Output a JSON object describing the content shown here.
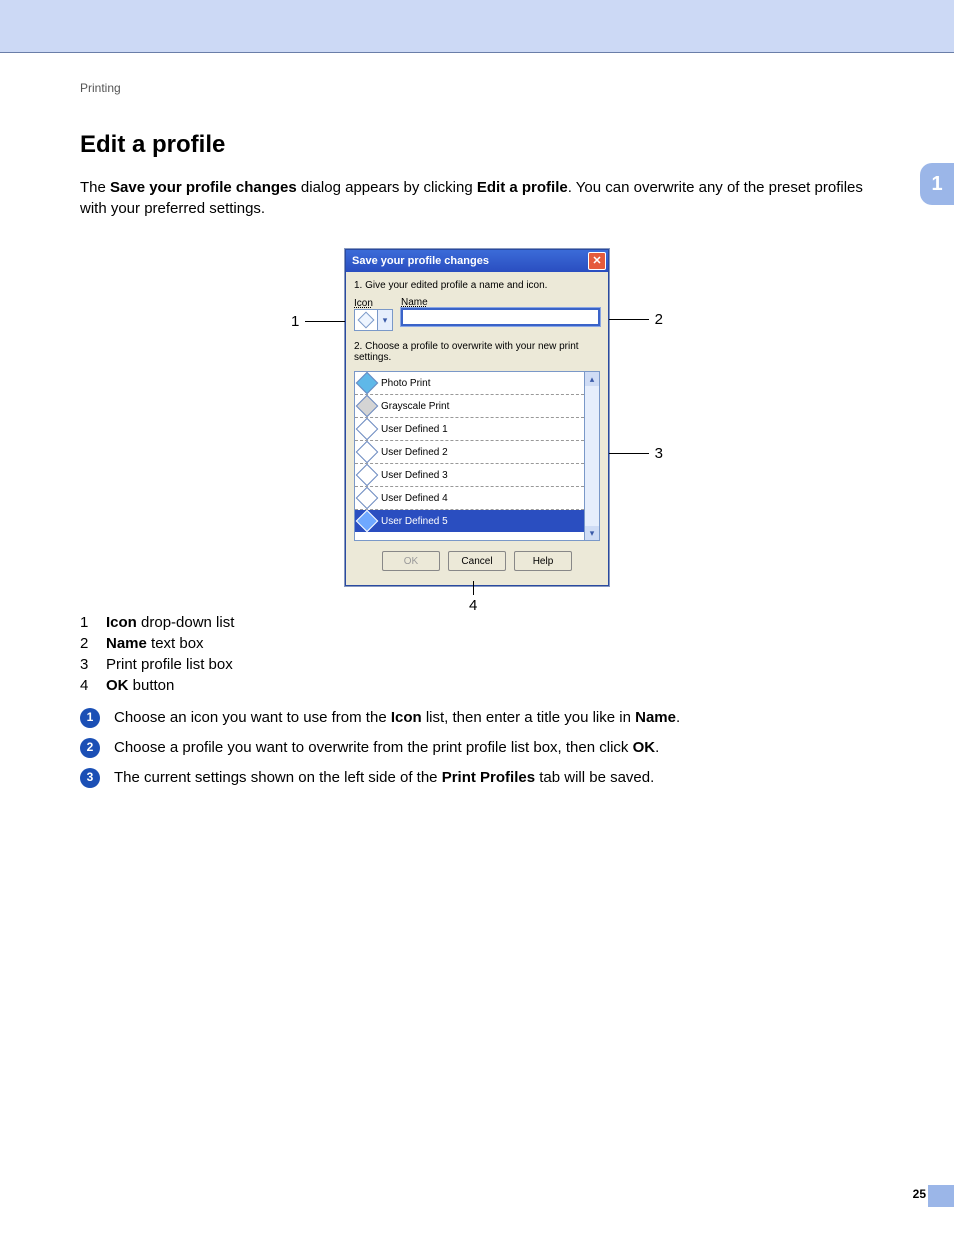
{
  "breadcrumb": "Printing",
  "side_tab": "1",
  "page_number": "25",
  "heading": "Edit a profile",
  "intro": {
    "pre": "The ",
    "bold1": "Save your profile changes",
    "mid1": " dialog appears by clicking ",
    "bold2": "Edit a profile",
    "post": ". You can overwrite any of the preset profiles with your preferred settings."
  },
  "dialog": {
    "title": "Save your profile changes",
    "step1": "1. Give your edited profile a name and icon.",
    "icon_label": "Icon",
    "name_label": "Name",
    "name_value": "",
    "step2": "2. Choose a profile to overwrite with your new print settings.",
    "profiles": [
      {
        "label": "Photo Print",
        "cls": "photo"
      },
      {
        "label": "Grayscale Print",
        "cls": "gray"
      },
      {
        "label": "User Defined 1",
        "cls": ""
      },
      {
        "label": "User Defined 2",
        "cls": ""
      },
      {
        "label": "User Defined 3",
        "cls": ""
      },
      {
        "label": "User Defined 4",
        "cls": ""
      },
      {
        "label": "User Defined 5",
        "cls": "selected"
      }
    ],
    "buttons": {
      "ok": "OK",
      "cancel": "Cancel",
      "help": "Help"
    }
  },
  "callouts": {
    "c1": "1",
    "c2": "2",
    "c3": "3",
    "c4": "4"
  },
  "legend": {
    "r1": {
      "n": "1",
      "pre": "",
      "b": "Icon",
      "post": " drop-down list"
    },
    "r2": {
      "n": "2",
      "pre": "",
      "b": "Name",
      "post": " text box"
    },
    "r3": {
      "n": "3",
      "text": "Print profile list box"
    },
    "r4": {
      "n": "4",
      "pre": "",
      "b": "OK",
      "post": " button"
    }
  },
  "steps": {
    "s1": {
      "pre": "Choose an icon you want to use from the ",
      "b1": "Icon",
      "mid": " list, then enter a title you like in ",
      "b2": "Name",
      "post": "."
    },
    "s2": {
      "pre": "Choose a profile you want to overwrite from the print profile list box, then click ",
      "b1": "OK",
      "post": "."
    },
    "s3": {
      "pre": "The current settings shown on the left side of the ",
      "b1": "Print Profiles",
      "post": " tab will be saved."
    }
  }
}
